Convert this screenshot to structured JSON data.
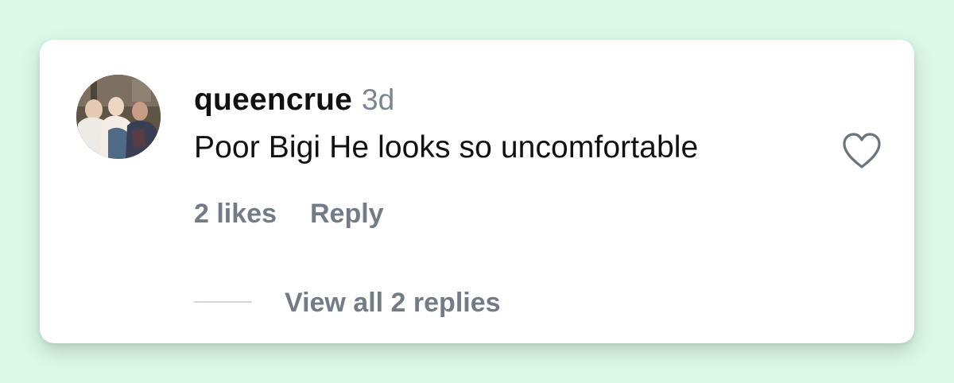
{
  "comment": {
    "username": "queencrue",
    "time_ago": "3d",
    "text": "Poor Bigi He looks so uncomfortable",
    "likes_label": "2 likes",
    "reply_label": "Reply",
    "view_replies_label": "View all 2 replies",
    "like_icon": "heart-outline-icon",
    "avatar": "user-photo-avatar"
  },
  "colors": {
    "page_background": "#dcf8e8",
    "card_background": "#ffffff",
    "primary_text": "#111111",
    "secondary_text": "#737b87",
    "heart_stroke": "#6b737d"
  }
}
